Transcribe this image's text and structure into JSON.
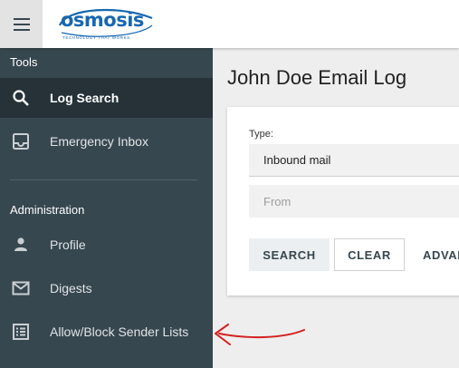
{
  "header": {
    "menu_icon": "hamburger-icon",
    "logo_text": "osmosis",
    "logo_tagline": "TECHNOLOGY THAT WORKS",
    "brand_color": "#1767b0"
  },
  "sidebar": {
    "tools_heading": "Tools",
    "tools_items": [
      {
        "label": "Log Search",
        "icon": "search-icon",
        "active": true
      },
      {
        "label": "Emergency Inbox",
        "icon": "inbox-icon",
        "active": false
      }
    ],
    "admin_heading": "Administration",
    "admin_items": [
      {
        "label": "Profile",
        "icon": "person-icon"
      },
      {
        "label": "Digests",
        "icon": "mail-icon"
      },
      {
        "label": "Allow/Block Sender Lists",
        "icon": "list-icon"
      }
    ],
    "background_color": "#37474f",
    "active_color": "#263238"
  },
  "main": {
    "title": "John Doe Email Log",
    "form": {
      "type_label": "Type:",
      "type_value": "Inbound mail",
      "from_placeholder": "From",
      "search_label": "SEARCH",
      "clear_label": "CLEAR",
      "advanced_label": "ADVAN"
    }
  },
  "annotation": {
    "arrow_color": "#d42020"
  }
}
